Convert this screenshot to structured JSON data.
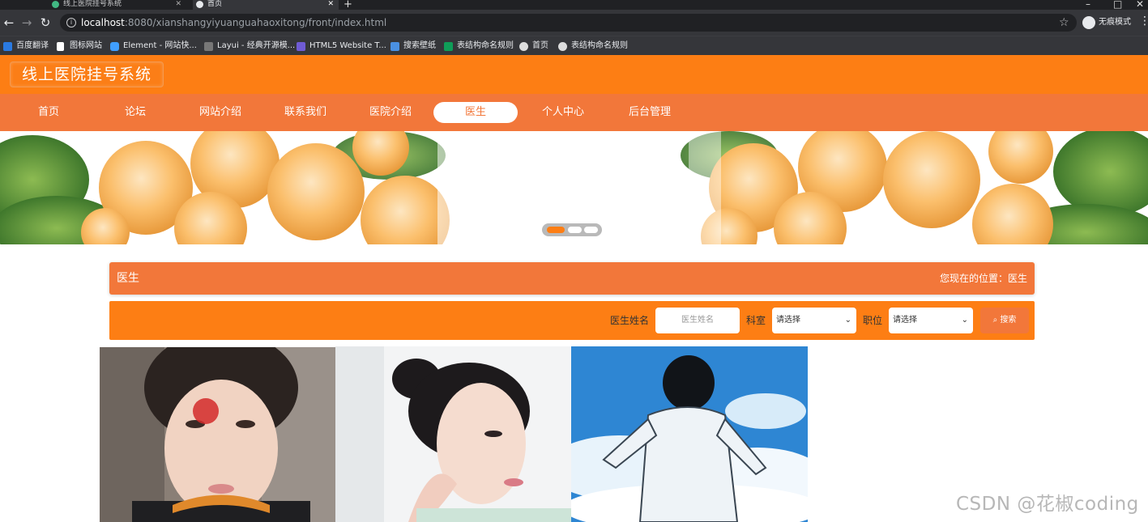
{
  "browser": {
    "tabs": [
      {
        "title": "线上医院挂号系统"
      },
      {
        "title": "首页"
      }
    ],
    "url": {
      "host": "localhost",
      "rest": ":8080/xianshangyiyuanguahaoxitong/front/index.html"
    },
    "incognito_label": "无痕模式",
    "bookmarks": [
      {
        "label": "百度翻译",
        "color": "#2a7ae2"
      },
      {
        "label": "图标网站",
        "color": "#ffffff"
      },
      {
        "label": "Element - 网站快...",
        "color": "#409eff"
      },
      {
        "label": "Layui - 经典开源模...",
        "color": "#cccccc"
      },
      {
        "label": "HTML5 Website T...",
        "color": "#6f5bd5"
      },
      {
        "label": "搜索壁纸",
        "color": "#4a90e2"
      },
      {
        "label": "表结构命名规则",
        "color": "#0f9d58"
      },
      {
        "label": "首页",
        "color": "#dddddd"
      },
      {
        "label": "表结构命名规则",
        "color": "#dddddd"
      }
    ]
  },
  "site": {
    "logo": "线上医院挂号系统",
    "nav": [
      {
        "label": "首页"
      },
      {
        "label": "论坛"
      },
      {
        "label": "网站介绍"
      },
      {
        "label": "联系我们"
      },
      {
        "label": "医院介绍"
      },
      {
        "label": "医生",
        "active": true
      },
      {
        "label": "个人中心"
      },
      {
        "label": "后台管理"
      }
    ]
  },
  "banner": {
    "active_slide": 1,
    "slide_count": 3
  },
  "breadcrumb": {
    "title": "医生",
    "location": "您现在的位置：医生"
  },
  "search": {
    "name_label": "医生姓名",
    "name_placeholder": "医生姓名",
    "dept_label": "科室",
    "dept_value": "请选择",
    "position_label": "职位",
    "position_value": "请选择",
    "button_label": "搜索"
  },
  "watermark": "CSDN @花椒coding",
  "colors": {
    "primary": "#fd7e14",
    "nav": "#f2773a"
  }
}
